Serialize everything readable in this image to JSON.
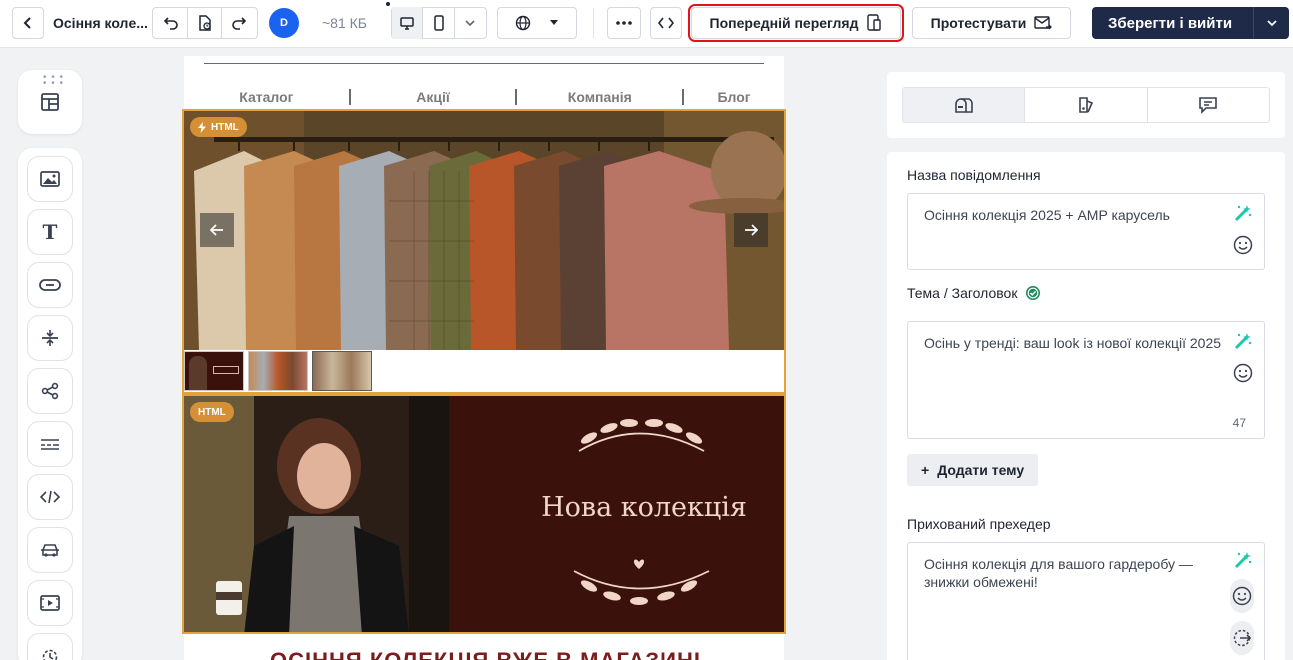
{
  "header": {
    "title": "Осіння колe...",
    "avatar_initial": "D",
    "size": "~81 КБ",
    "preview_label": "Попередній перегляд",
    "test_label": "Протестувати",
    "save_label": "Зберегти і вийти"
  },
  "email": {
    "nav": [
      "Каталог",
      "Акції",
      "Компанія",
      "Блог"
    ],
    "html_tag": "HTML",
    "banner_title": "Нова колекція",
    "below_title": "ОСІННЯ КОЛЕКЦІЯ ВЖЕ В МАГАЗИНІ"
  },
  "panel": {
    "name_label": "Назва повідомлення",
    "name_value": "Осіння колекція 2025 + AMP карусель",
    "subject_label": "Тема / Заголовок",
    "subject_value": "Осінь у тренді: ваш look із нової колекції 2025",
    "subject_count": "47",
    "add_topic_label": "Додати тему",
    "preheader_label": "Прихований прехедер",
    "preheader_value": "Осіння колекція для вашого гардеробу — знижки обмежені!"
  },
  "colors": {
    "accent_border": "#e3a23b",
    "highlight": "#e0121b",
    "save_bg": "#1e2a47",
    "avatar_bg": "#1a62f0"
  },
  "icons": {
    "tabs": [
      "mailbox-icon",
      "palette-icon",
      "comment-icon"
    ],
    "tools": [
      "image-icon",
      "text-icon",
      "button-icon",
      "divider-icon",
      "share-icon",
      "menu-icon",
      "code-icon",
      "car-icon",
      "video-icon",
      "timer-icon"
    ]
  }
}
